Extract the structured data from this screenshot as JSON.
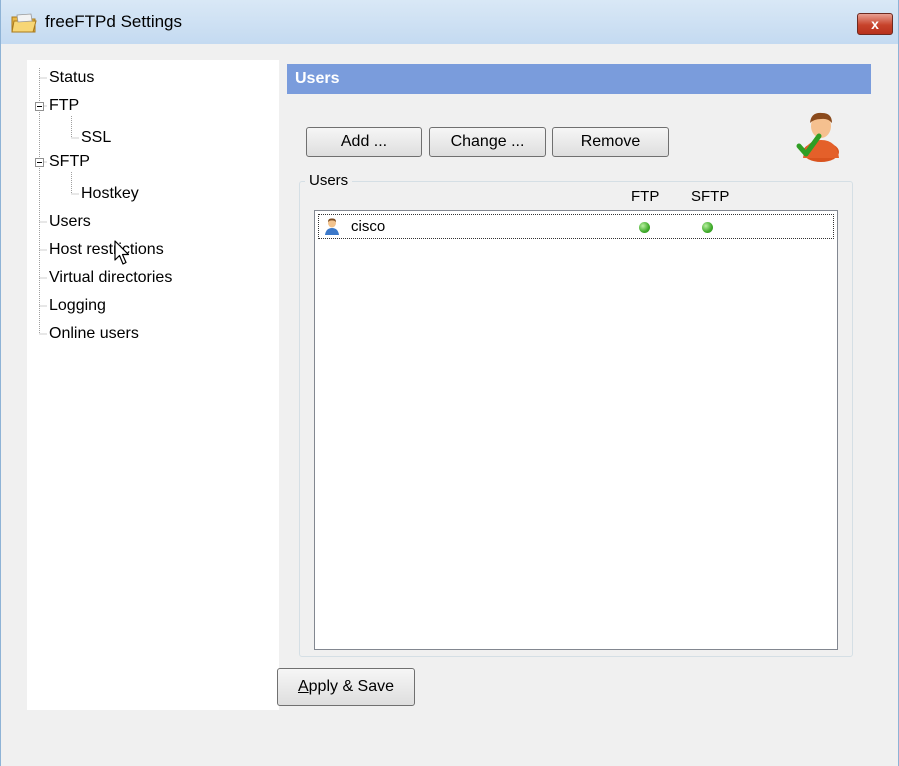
{
  "window": {
    "title": "freeFTPd Settings",
    "close_label": "x"
  },
  "tree": {
    "items": [
      {
        "label": "Status"
      },
      {
        "label": "FTP"
      },
      {
        "label": "SSL"
      },
      {
        "label": "SFTP"
      },
      {
        "label": "Hostkey"
      },
      {
        "label": "Users"
      },
      {
        "label": "Host restrictions"
      },
      {
        "label": "Virtual directories"
      },
      {
        "label": "Logging"
      },
      {
        "label": "Online users"
      }
    ]
  },
  "panel": {
    "header": "Users",
    "buttons": {
      "add": "Add ...",
      "change": "Change ...",
      "remove": "Remove"
    },
    "group_label": "Users",
    "columns": {
      "ftp": "FTP",
      "sftp": "SFTP"
    },
    "users": [
      {
        "name": "cisco",
        "ftp": true,
        "sftp": true
      }
    ]
  },
  "footer": {
    "apply_first_letter": "A",
    "apply_rest": "pply & Save"
  },
  "colors": {
    "header_bg": "#7a9cdc",
    "status_on": "#3faa2a"
  }
}
